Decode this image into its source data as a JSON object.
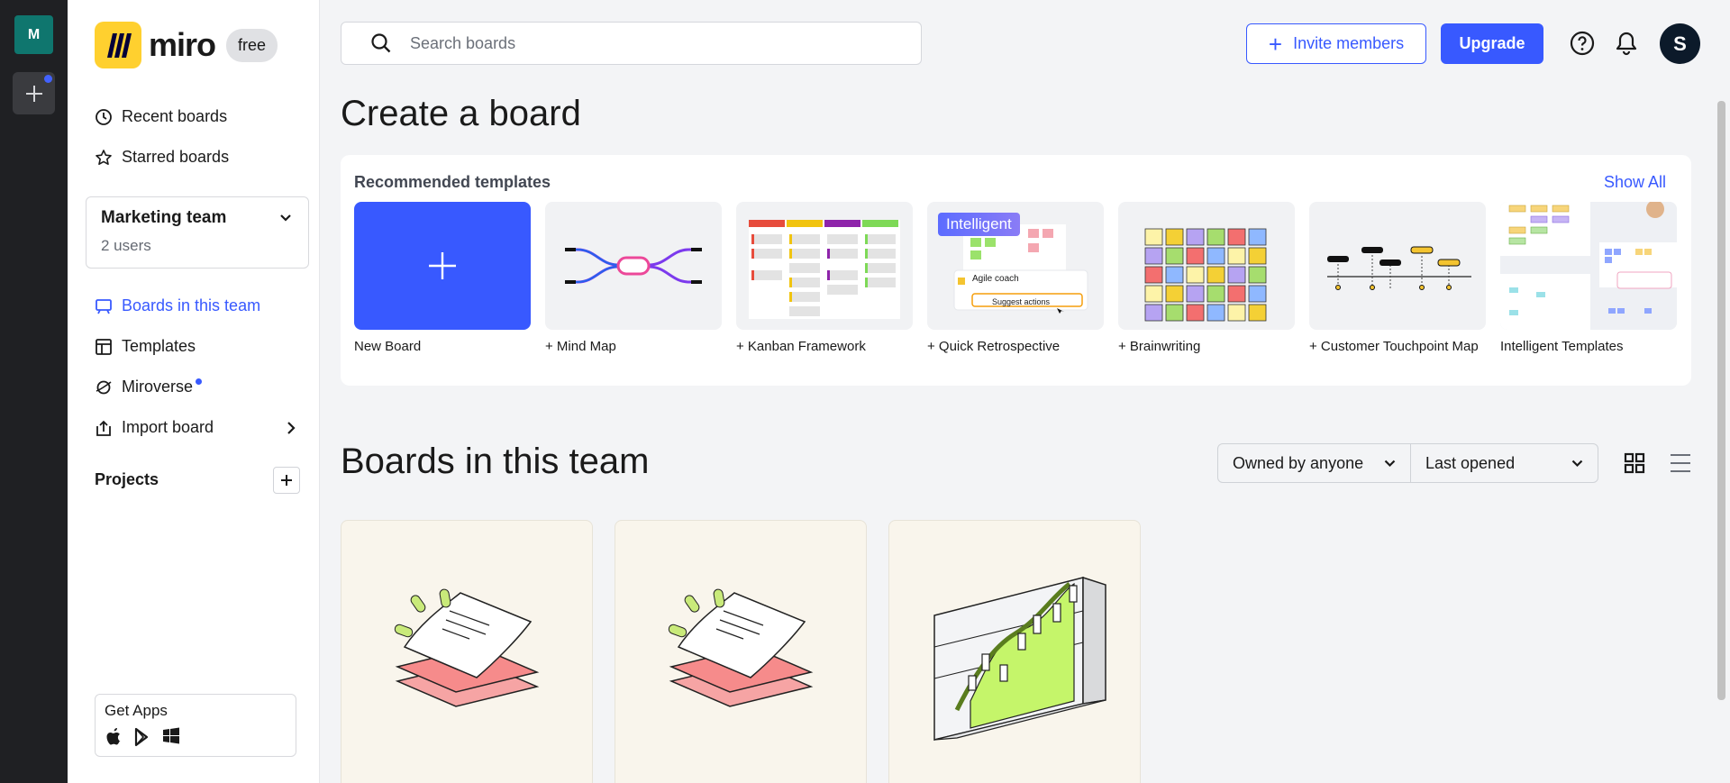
{
  "rail": {
    "team_initial": "M"
  },
  "logo": {
    "text": "miro",
    "plan": "free"
  },
  "sidebar": {
    "nav_top": [
      {
        "label": "Recent boards",
        "icon": "clock-icon"
      },
      {
        "label": "Starred boards",
        "icon": "star-icon"
      }
    ],
    "team": {
      "name": "Marketing team",
      "users": "2 users"
    },
    "nav_main": [
      {
        "label": "Boards in this team",
        "icon": "board-icon"
      },
      {
        "label": "Templates",
        "icon": "template-icon"
      },
      {
        "label": "Miroverse",
        "icon": "planet-icon"
      },
      {
        "label": "Import board",
        "icon": "import-icon"
      }
    ],
    "projects_title": "Projects",
    "get_apps": "Get Apps"
  },
  "topbar": {
    "search_placeholder": "Search boards",
    "invite_label": "Invite members",
    "upgrade_label": "Upgrade",
    "avatar_initial": "S"
  },
  "create": {
    "title": "Create a board",
    "recommended": "Recommended templates",
    "show_all": "Show All",
    "templates": [
      {
        "label": "New Board"
      },
      {
        "label": "+ Mind Map"
      },
      {
        "label": "+ Kanban Framework"
      },
      {
        "label": "+ Quick Retrospective",
        "badge": "Intelligent",
        "card_title": "Agile coach",
        "card_action": "Suggest actions"
      },
      {
        "label": "+ Brainwriting"
      },
      {
        "label": "+ Customer Touchpoint Map"
      },
      {
        "label": "Intelligent Templates"
      }
    ]
  },
  "boards": {
    "title": "Boards in this team",
    "owner_filter": "Owned by anyone",
    "sort_filter": "Last opened"
  },
  "colors": {
    "accent": "#3859ff",
    "logo": "#ffd02f",
    "rail": "#1f2023"
  }
}
